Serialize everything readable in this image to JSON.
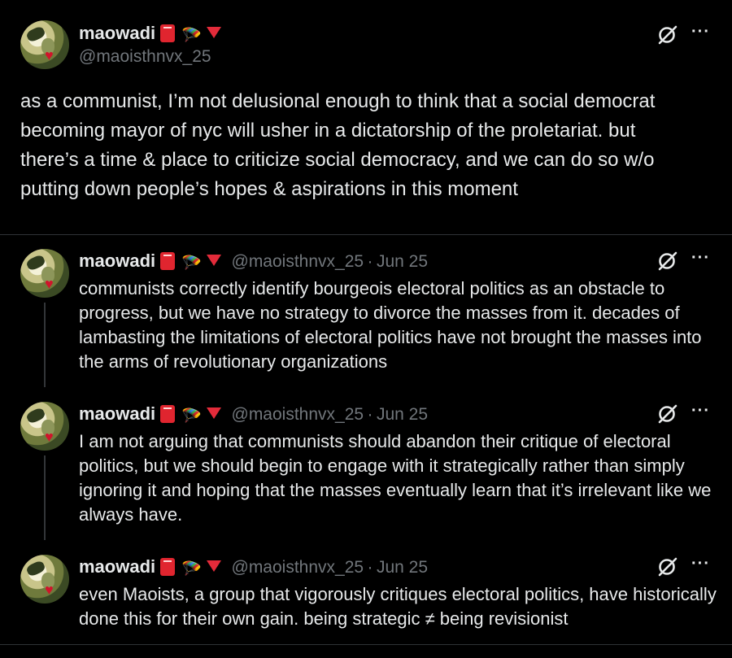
{
  "main_tweet": {
    "name": "maowadi",
    "handle": "@maoisthnvx_25",
    "text": "as a communist, I’m not delusional enough to think that a social democrat becoming mayor of nyc will usher in a dictatorship of the proletariat. but there’s a time & place to criticize social democracy, and we can do so w/o putting down people’s hopes & aspirations in this moment"
  },
  "replies": [
    {
      "name": "maowadi",
      "handle": "@maoisthnvx_25",
      "sep": "·",
      "date": "Jun 25",
      "text": "communists correctly identify bourgeois electoral politics as an obstacle to progress, but we have no strategy to divorce the masses from it. decades of lambasting the limitations of electoral politics have not brought the masses into the arms of revolutionary organizations"
    },
    {
      "name": "maowadi",
      "handle": "@maoisthnvx_25",
      "sep": "·",
      "date": "Jun 25",
      "text": "I am not arguing that communists should abandon their critique of electoral politics, but we should begin to engage with it strategically rather than simply ignoring it and hoping that the masses eventually learn that it’s irrelevant like we always have."
    },
    {
      "name": "maowadi",
      "handle": "@maoisthnvx_25",
      "sep": "·",
      "date": "Jun 25",
      "text": "even Maoists, a group that vigorously critiques electoral politics, have historically done this for their own gain. being strategic ≠ being revisionist"
    }
  ],
  "icons": {
    "more": "···",
    "grok": "grok-icon",
    "book_emoji": "red-book-emoji",
    "parachute_emoji": "parachute-emoji",
    "triangle_emoji": "red-triangle-emoji"
  },
  "colors": {
    "background": "#000000",
    "text": "#e7e9ea",
    "secondary": "#71767b",
    "divider": "#2f3336"
  }
}
